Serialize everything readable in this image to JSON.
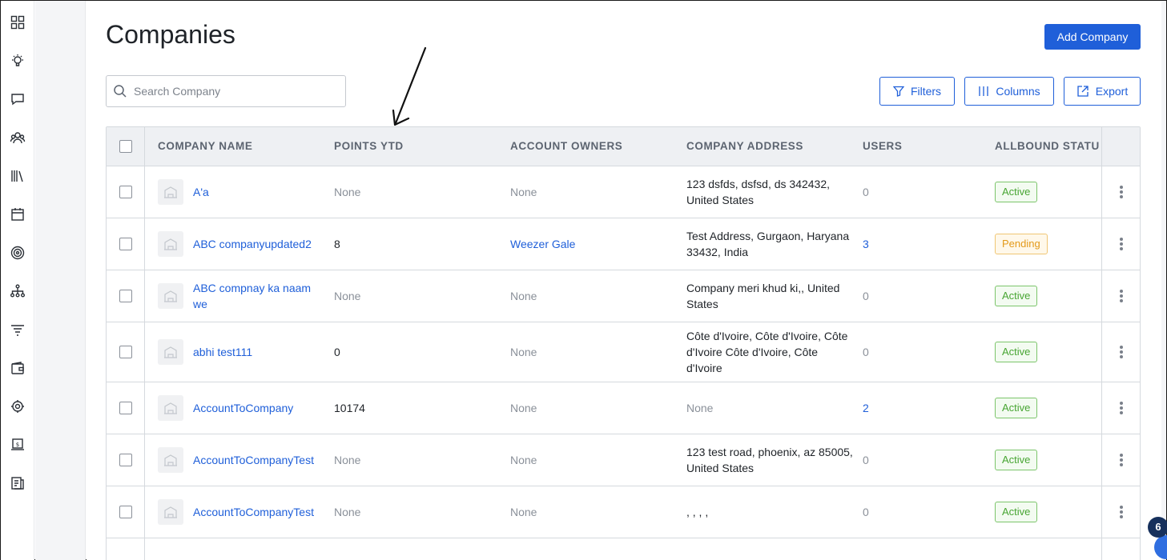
{
  "page": {
    "title": "Companies"
  },
  "actions": {
    "add_company": "Add Company",
    "filters": "Filters",
    "columns": "Columns",
    "export": "Export"
  },
  "search": {
    "placeholder": "Search Company",
    "value": ""
  },
  "sidebar": {
    "icons": [
      "dashboard-icon",
      "lightbulb-icon",
      "chat-icon",
      "users-icon",
      "library-icon",
      "calendar-icon",
      "target-icon",
      "hierarchy-icon",
      "filter-icon",
      "wallet-icon",
      "settings-icon",
      "billing-icon",
      "reports-icon"
    ]
  },
  "table": {
    "headers": {
      "company_name": "COMPANY NAME",
      "points_ytd": "POINTS YTD",
      "account_owners": "ACCOUNT OWNERS",
      "company_address": "COMPANY ADDRESS",
      "users": "USERS",
      "allbound_status": "ALLBOUND STATU"
    },
    "rows": [
      {
        "name": "A'a",
        "points": "None",
        "owners": "None",
        "address": "123 dsfds, dsfsd, ds 342432, United States",
        "users": "0",
        "status": "Active"
      },
      {
        "name": "ABC companyupdated2",
        "points": "8",
        "owners": "Weezer Gale",
        "address": "Test Address, Gurgaon, Haryana 33432, India",
        "users": "3",
        "status": "Pending"
      },
      {
        "name": "ABC compnay ka naam we",
        "points": "None",
        "owners": "None",
        "address": "Company meri khud ki,, United States",
        "users": "0",
        "status": "Active"
      },
      {
        "name": "abhi test111",
        "points": "0",
        "owners": "None",
        "address": "Côte d'Ivoire, Côte d'Ivoire, Côte d'Ivoire Côte d'Ivoire, Côte d'Ivoire",
        "users": "0",
        "status": "Active"
      },
      {
        "name": "AccountToCompany",
        "points": "10174",
        "owners": "None",
        "address": "None",
        "users": "2",
        "status": "Active"
      },
      {
        "name": "AccountToCompanyTest",
        "points": "None",
        "owners": "None",
        "address": "123 test road, phoenix, az 85005, United States",
        "users": "0",
        "status": "Active"
      },
      {
        "name": "AccountToCompanyTest",
        "points": "None",
        "owners": "None",
        "address": ", , , ,",
        "users": "0",
        "status": "Active"
      }
    ]
  },
  "notification": {
    "count": "6"
  },
  "colors": {
    "accent": "#1f5fd9",
    "active": "#47a532",
    "pending": "#e39a1b"
  }
}
